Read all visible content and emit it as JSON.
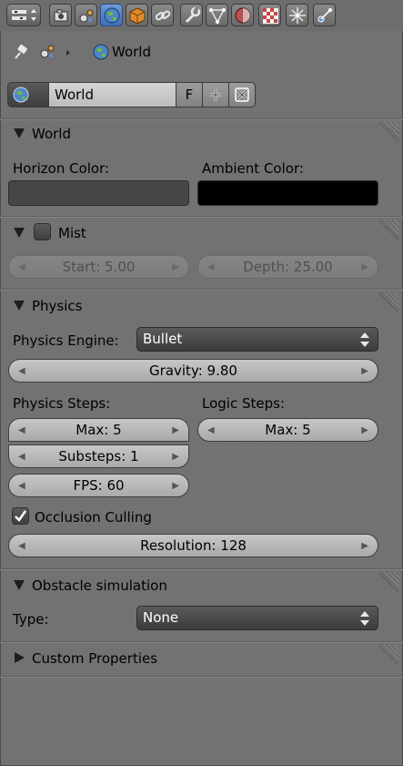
{
  "breadcrumb": {
    "label": "World"
  },
  "datablock": {
    "name": "World",
    "fake_user": "F"
  },
  "world_panel": {
    "title": "World",
    "horizon_label": "Horizon Color:",
    "ambient_label": "Ambient Color:",
    "horizon_color": "#464646",
    "ambient_color": "#000000"
  },
  "mist_panel": {
    "title": "Mist",
    "enabled": false,
    "start": "Start: 5.00",
    "depth": "Depth: 25.00"
  },
  "physics_panel": {
    "title": "Physics",
    "engine_label": "Physics Engine:",
    "engine_value": "Bullet",
    "gravity": "Gravity: 9.80",
    "physics_steps_label": "Physics Steps:",
    "logic_steps_label": "Logic Steps:",
    "max_physics": "Max: 5",
    "substeps": "Substeps: 1",
    "fps": "FPS: 60",
    "max_logic": "Max: 5",
    "occlusion_label": "Occlusion Culling",
    "occlusion_checked": true,
    "resolution": "Resolution: 128"
  },
  "obstacle_panel": {
    "title": "Obstacle simulation",
    "type_label": "Type:",
    "type_value": "None"
  },
  "custom_panel": {
    "title": "Custom Properties"
  },
  "toolbar": {
    "tabs": [
      "render-icon",
      "scene-icon",
      "world-icon",
      "object-icon",
      "constraints-icon",
      "modifiers-icon",
      "data-icon",
      "material-icon",
      "texture-icon",
      "particles-icon",
      "physics-icon"
    ],
    "active_tab": "world-icon"
  }
}
